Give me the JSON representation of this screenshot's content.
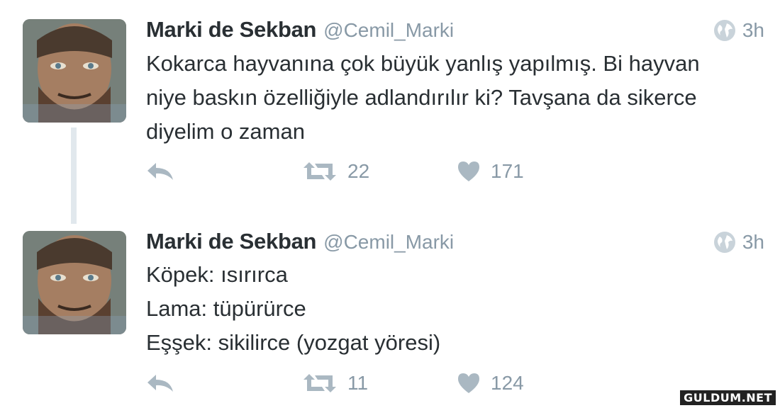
{
  "colors": {
    "text": "#292f33",
    "muted": "#8899a6",
    "icon": "#aab8c2",
    "thread": "#e1e8ed"
  },
  "tweets": [
    {
      "name": "Marki de Sekban",
      "handle": "@Cemil_Marki",
      "time": "3h",
      "lines": [
        "Kokarca hayvanına çok büyük yanlış yapılmış. Bi hayvan",
        "niye baskın özelliğiyle adlandırılır ki? Tavşana da sikerce",
        "diyelim o zaman"
      ],
      "retweets": "22",
      "likes": "171"
    },
    {
      "name": "Marki de Sekban",
      "handle": "@Cemil_Marki",
      "time": "3h",
      "lines": [
        "Köpek: ısırırca",
        "Lama: tüpürürce",
        "Eşşek: sikilirce (yozgat yöresi)"
      ],
      "retweets": "11",
      "likes": "124"
    }
  ],
  "icons": [
    "globe-icon",
    "reply-icon",
    "retweet-icon",
    "heart-icon"
  ],
  "watermark": "GULDUM.NET"
}
